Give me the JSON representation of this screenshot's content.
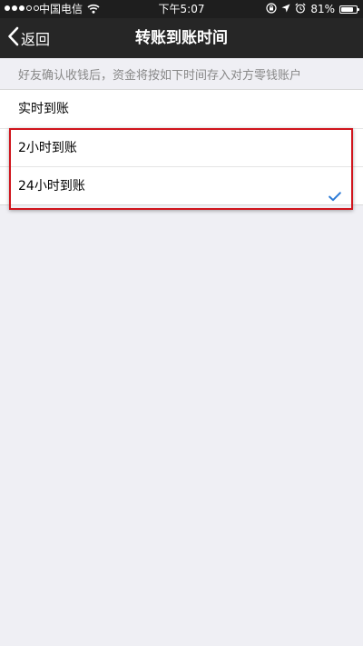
{
  "status_bar": {
    "signal_filled": 3,
    "signal_total": 5,
    "carrier": "中国电信",
    "time": "下午5:07",
    "battery_percent_text": "81%",
    "battery_level": 0.81
  },
  "nav": {
    "back_label": "返回",
    "title": "转账到账时间"
  },
  "section_header": "好友确认收钱后，资金将按如下时间存入对方零钱账户",
  "options": [
    {
      "label": "实时到账",
      "selected": false
    },
    {
      "label": "2小时到账",
      "selected": false
    },
    {
      "label": "24小时到账",
      "selected": true
    }
  ],
  "colors": {
    "check_mark": "#2b7ad6",
    "highlight_box": "#d0141c",
    "nav_background": "#262626",
    "page_background": "#efeff4"
  },
  "icons": {
    "wifi": "wifi-icon",
    "lock": "rotation-lock-icon",
    "location": "location-arrow-icon",
    "alarm": "alarm-clock-icon",
    "battery": "battery-icon",
    "back": "chevron-left-icon",
    "check": "checkmark-icon"
  }
}
